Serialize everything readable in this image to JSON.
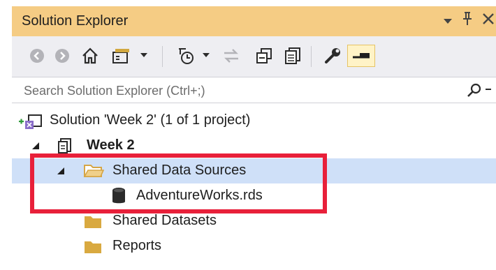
{
  "window": {
    "title": "Solution Explorer",
    "controls": {
      "dropdown": "▾",
      "pin": "ᵖ",
      "close": "✕"
    }
  },
  "toolbar": {
    "icons": [
      "back-icon",
      "forward-icon",
      "home-icon",
      "switch-views-icon",
      "dropdown-icon",
      "pending-changes-icon",
      "dropdown-icon",
      "sync-icon",
      "collapse-all-icon",
      "show-all-files-icon",
      "properties-icon",
      "preview-icon"
    ]
  },
  "search": {
    "placeholder": "Search Solution Explorer (Ctrl+;)"
  },
  "tree": {
    "solution": "Solution 'Week 2' (1 of 1 project)",
    "project": "Week 2",
    "folders": [
      {
        "label": "Shared Data Sources",
        "expanded": true,
        "selected": true,
        "children": [
          {
            "label": "AdventureWorks.rds",
            "icon": "database-icon"
          }
        ]
      },
      {
        "label": "Shared Datasets",
        "expanded": false
      },
      {
        "label": "Reports",
        "expanded": false
      }
    ]
  },
  "colors": {
    "title_bar": "#f5cc84",
    "toolbar": "#eeeef2",
    "selection": "#cfe0f8",
    "highlight": "#e8203a"
  }
}
